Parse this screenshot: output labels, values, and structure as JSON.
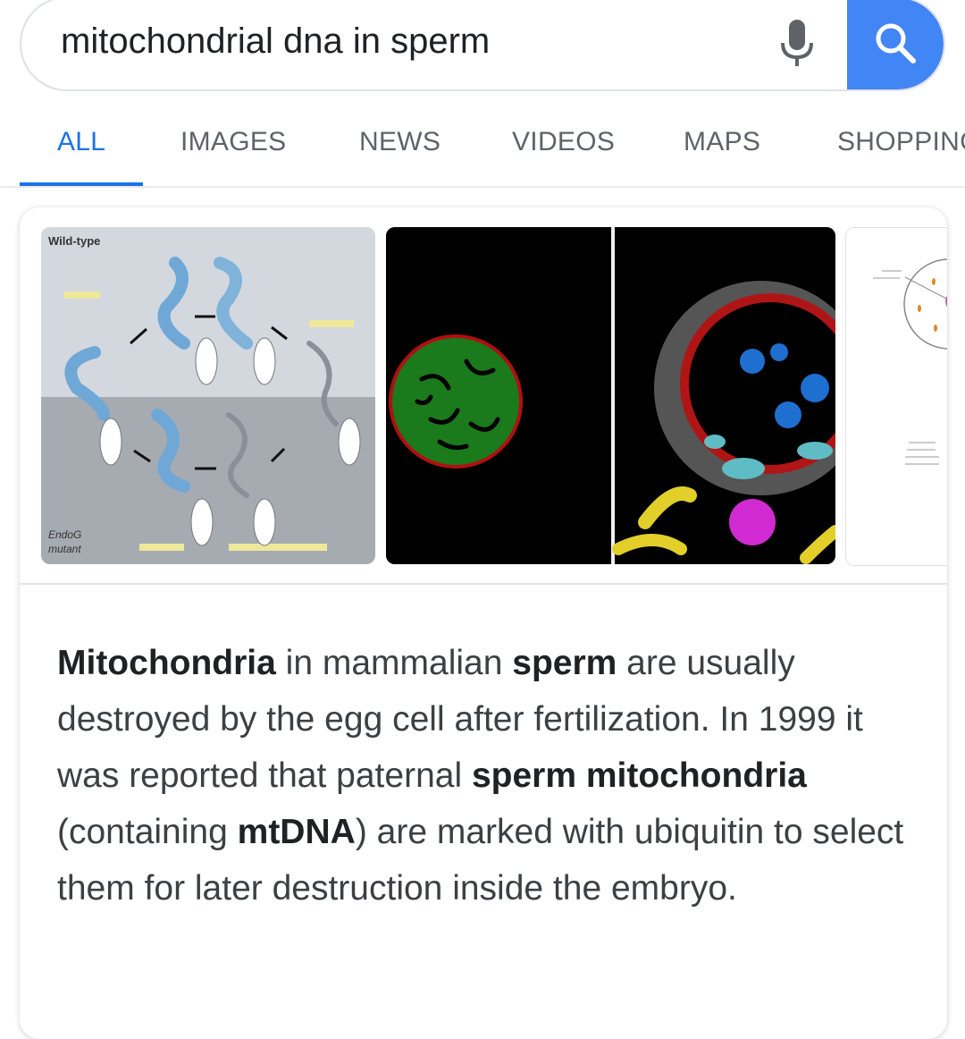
{
  "search": {
    "query": "mitochondrial dna in sperm"
  },
  "tabs": [
    {
      "label": "ALL",
      "active": true
    },
    {
      "label": "IMAGES"
    },
    {
      "label": "NEWS"
    },
    {
      "label": "VIDEOS"
    },
    {
      "label": "MAPS"
    },
    {
      "label": "SHOPPING"
    }
  ],
  "images": {
    "thumb1": {
      "label_top": "Wild-type",
      "label_bottom_1": "EndoG",
      "label_bottom_2": "mutant"
    }
  },
  "snippet": {
    "s1": "Mitochondria",
    "s2": " in mammalian ",
    "s3": "sperm",
    "s4": " are usually destroyed by the egg cell after fertilization. In 1999 it was reported that paternal ",
    "s5": "sperm mitochondria",
    "s6": " (containing ",
    "s7": "mtDNA",
    "s8": ") are marked with ubiquitin to select them for later destruction inside the embryo."
  },
  "colors": {
    "accent": "#1a73e8",
    "search_button": "#4285f4"
  },
  "icons": [
    "mic-icon",
    "search-icon"
  ]
}
